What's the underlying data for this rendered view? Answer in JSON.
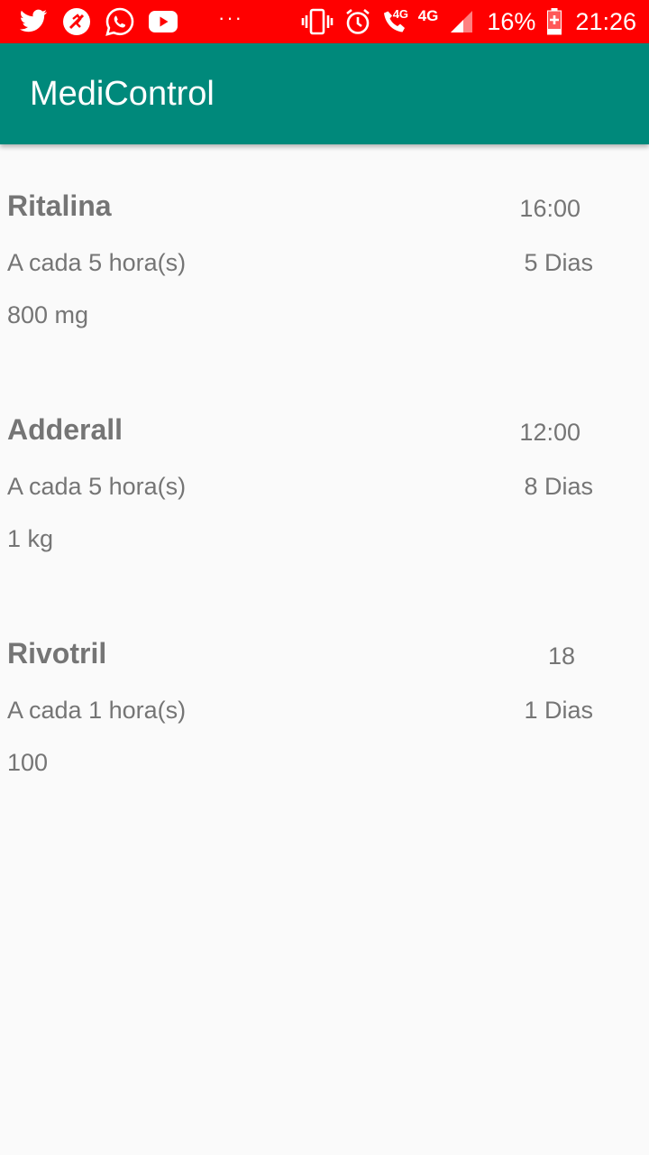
{
  "status_bar": {
    "notification_icons": [
      "twitter-icon",
      "no-disturb-icon",
      "whatsapp-icon",
      "youtube-icon"
    ],
    "overflow": "···",
    "system_icons": [
      "vibrate-icon",
      "alarm-icon",
      "volte-call-icon",
      "4g-icon",
      "signal-icon",
      "battery-charging-icon"
    ],
    "volte_label": "4G",
    "network_label": "4G",
    "battery": "16%",
    "time": "21:26",
    "background_color": "#ff0000"
  },
  "app_bar": {
    "title": "MediControl",
    "background_color": "#00897b"
  },
  "medications": [
    {
      "name": "Ritalina",
      "time": "16:00",
      "interval": "A cada 5 hora(s)",
      "days": "5 Dias",
      "dose": "800 mg"
    },
    {
      "name": "Adderall",
      "time": "12:00",
      "interval": "A cada 5 hora(s)",
      "days": "8 Dias",
      "dose": "1 kg"
    },
    {
      "name": "Rivotril",
      "time": "18",
      "interval": "A cada 1 hora(s)",
      "days": "1 Dias",
      "dose": "100"
    }
  ]
}
